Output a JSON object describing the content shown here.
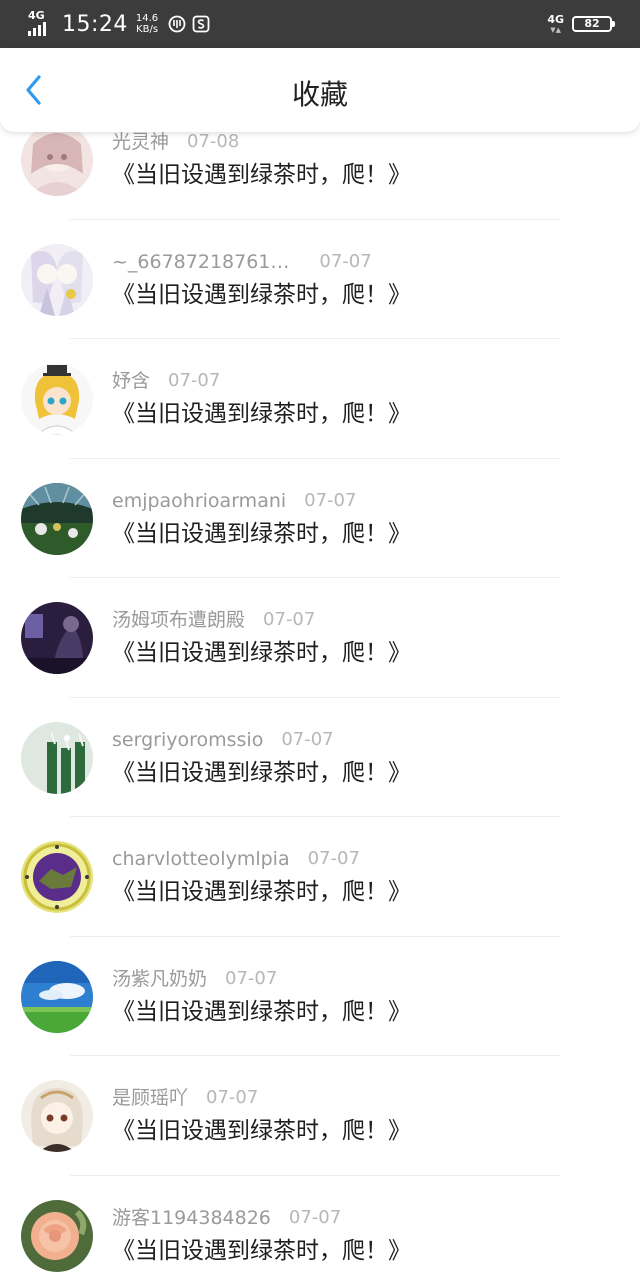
{
  "status_bar": {
    "network_left": "4G",
    "time": "15:24",
    "speed_value": "14.6",
    "speed_unit": "KB/s",
    "network_right": "4G",
    "battery": "82"
  },
  "header": {
    "title": "收藏",
    "back_icon": "chevron-left-icon"
  },
  "colors": {
    "accent": "#2f9bf0",
    "status_bar_bg": "#3c3c3c",
    "username_text": "#9a9a9a",
    "date_text": "#b7b7b7",
    "title_text": "#1f1f1f"
  },
  "items": [
    {
      "user": "光灵神",
      "date": "07-08",
      "title": "《当旧设遇到绿茶时，爬！》"
    },
    {
      "user": "~_66787218761…",
      "date": "07-07",
      "title": "《当旧设遇到绿茶时，爬！》"
    },
    {
      "user": "妤含",
      "date": "07-07",
      "title": "《当旧设遇到绿茶时，爬！》"
    },
    {
      "user": "emjpaohrioarmani",
      "date": "07-07",
      "title": "《当旧设遇到绿茶时，爬！》"
    },
    {
      "user": "汤姆项布遭朗殿",
      "date": "07-07",
      "title": "《当旧设遇到绿茶时，爬！》"
    },
    {
      "user": "sergriyoromssio",
      "date": "07-07",
      "title": "《当旧设遇到绿茶时，爬！》"
    },
    {
      "user": "charvlotteolymlpia",
      "date": "07-07",
      "title": "《当旧设遇到绿茶时，爬！》"
    },
    {
      "user": "汤紫凡奶奶",
      "date": "07-07",
      "title": "《当旧设遇到绿茶时，爬！》"
    },
    {
      "user": "是顾瑶吖",
      "date": "07-07",
      "title": "《当旧设遇到绿茶时，爬！》"
    },
    {
      "user": "游客1194384826",
      "date": "07-07",
      "title": "《当旧设遇到绿茶时，爬！》"
    }
  ]
}
